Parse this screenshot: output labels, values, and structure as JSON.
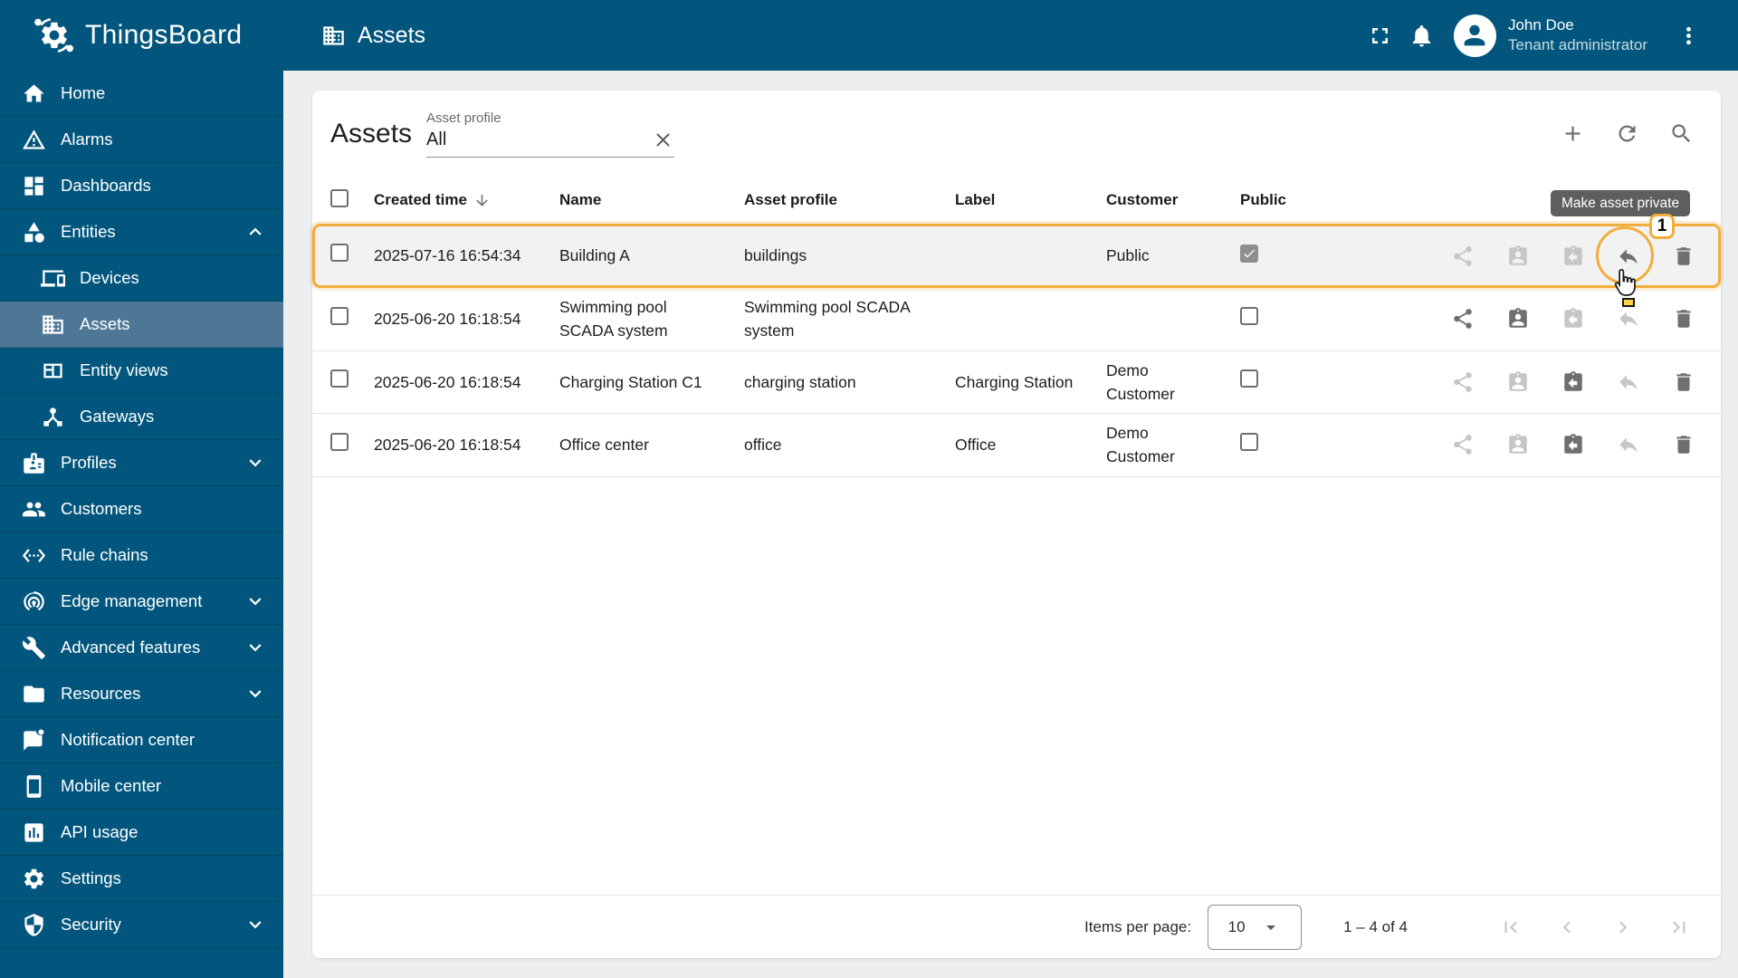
{
  "colors": {
    "primary": "#02567d",
    "active": "#4e7695",
    "accent": "#f2ad3c",
    "tooltip": "#5e5e5e"
  },
  "header": {
    "logo_text": "ThingsBoard",
    "page_title": "Assets",
    "user": {
      "name": "John Doe",
      "role": "Tenant administrator"
    }
  },
  "sidebar": {
    "items": [
      {
        "label": "Home",
        "icon": "home"
      },
      {
        "label": "Alarms",
        "icon": "warning"
      },
      {
        "label": "Dashboards",
        "icon": "dashboard"
      },
      {
        "label": "Entities",
        "icon": "category",
        "chevron": "up"
      },
      {
        "label": "Devices",
        "icon": "devices",
        "child": true
      },
      {
        "label": "Assets",
        "icon": "domain",
        "child": true,
        "active": true
      },
      {
        "label": "Entity views",
        "icon": "view_quilt",
        "child": true
      },
      {
        "label": "Gateways",
        "icon": "device_hub",
        "child": true
      },
      {
        "label": "Profiles",
        "icon": "badge",
        "chevron": "down"
      },
      {
        "label": "Customers",
        "icon": "people"
      },
      {
        "label": "Rule chains",
        "icon": "settings_ethernet"
      },
      {
        "label": "Edge management",
        "icon": "wifi_tethering",
        "chevron": "down"
      },
      {
        "label": "Advanced features",
        "icon": "build",
        "chevron": "down"
      },
      {
        "label": "Resources",
        "icon": "folder",
        "chevron": "down"
      },
      {
        "label": "Notification center",
        "icon": "notification"
      },
      {
        "label": "Mobile center",
        "icon": "smartphone"
      },
      {
        "label": "API usage",
        "icon": "insert_chart"
      },
      {
        "label": "Settings",
        "icon": "settings"
      },
      {
        "label": "Security",
        "icon": "security",
        "chevron": "down"
      }
    ]
  },
  "main": {
    "title": "Assets",
    "filter": {
      "label": "Asset profile",
      "value": "All"
    },
    "table": {
      "columns": [
        "Created time",
        "Name",
        "Asset profile",
        "Label",
        "Customer",
        "Public"
      ],
      "rows": [
        {
          "created": "2025-07-16 16:54:34",
          "name": "Building A",
          "profile": "buildings",
          "label": "",
          "customer": "Public",
          "public": true,
          "highlighted": true,
          "actions": [
            {
              "name": "make-asset-public",
              "icon": "share",
              "enabled": false
            },
            {
              "name": "assign-to-customer",
              "icon": "assignment_ind",
              "enabled": false
            },
            {
              "name": "unassign-from-customer",
              "icon": "assignment_return",
              "enabled": false
            },
            {
              "name": "make-asset-private",
              "icon": "reply",
              "enabled": true
            },
            {
              "name": "delete-asset",
              "icon": "delete",
              "enabled": true
            }
          ]
        },
        {
          "created": "2025-06-20 16:18:54",
          "name": "Swimming pool SCADA system",
          "profile": "Swimming pool SCADA system",
          "label": "",
          "customer": "",
          "public": false,
          "actions": [
            {
              "name": "make-asset-public",
              "icon": "share",
              "enabled": true
            },
            {
              "name": "assign-to-customer",
              "icon": "assignment_ind",
              "enabled": true
            },
            {
              "name": "unassign-from-customer",
              "icon": "assignment_return",
              "enabled": false
            },
            {
              "name": "make-asset-private",
              "icon": "reply",
              "enabled": false
            },
            {
              "name": "delete-asset",
              "icon": "delete",
              "enabled": true
            }
          ]
        },
        {
          "created": "2025-06-20 16:18:54",
          "name": "Charging Station C1",
          "profile": "charging station",
          "label": "Charging Station",
          "customer": "Demo Customer",
          "public": false,
          "actions": [
            {
              "name": "make-asset-public",
              "icon": "share",
              "enabled": false
            },
            {
              "name": "assign-to-customer",
              "icon": "assignment_ind",
              "enabled": false
            },
            {
              "name": "unassign-from-customer",
              "icon": "assignment_return",
              "enabled": true
            },
            {
              "name": "make-asset-private",
              "icon": "reply",
              "enabled": false
            },
            {
              "name": "delete-asset",
              "icon": "delete",
              "enabled": true
            }
          ]
        },
        {
          "created": "2025-06-20 16:18:54",
          "name": "Office center",
          "profile": "office",
          "label": "Office",
          "customer": "Demo Customer",
          "public": false,
          "actions": [
            {
              "name": "make-asset-public",
              "icon": "share",
              "enabled": false
            },
            {
              "name": "assign-to-customer",
              "icon": "assignment_ind",
              "enabled": false
            },
            {
              "name": "unassign-from-customer",
              "icon": "assignment_return",
              "enabled": true
            },
            {
              "name": "make-asset-private",
              "icon": "reply",
              "enabled": false
            },
            {
              "name": "delete-asset",
              "icon": "delete",
              "enabled": true
            }
          ]
        }
      ]
    },
    "pagination": {
      "label": "Items per page:",
      "value": "10",
      "range": "1 – 4 of 4"
    }
  },
  "overlay": {
    "tooltip": "Make asset private",
    "badge": "1"
  }
}
